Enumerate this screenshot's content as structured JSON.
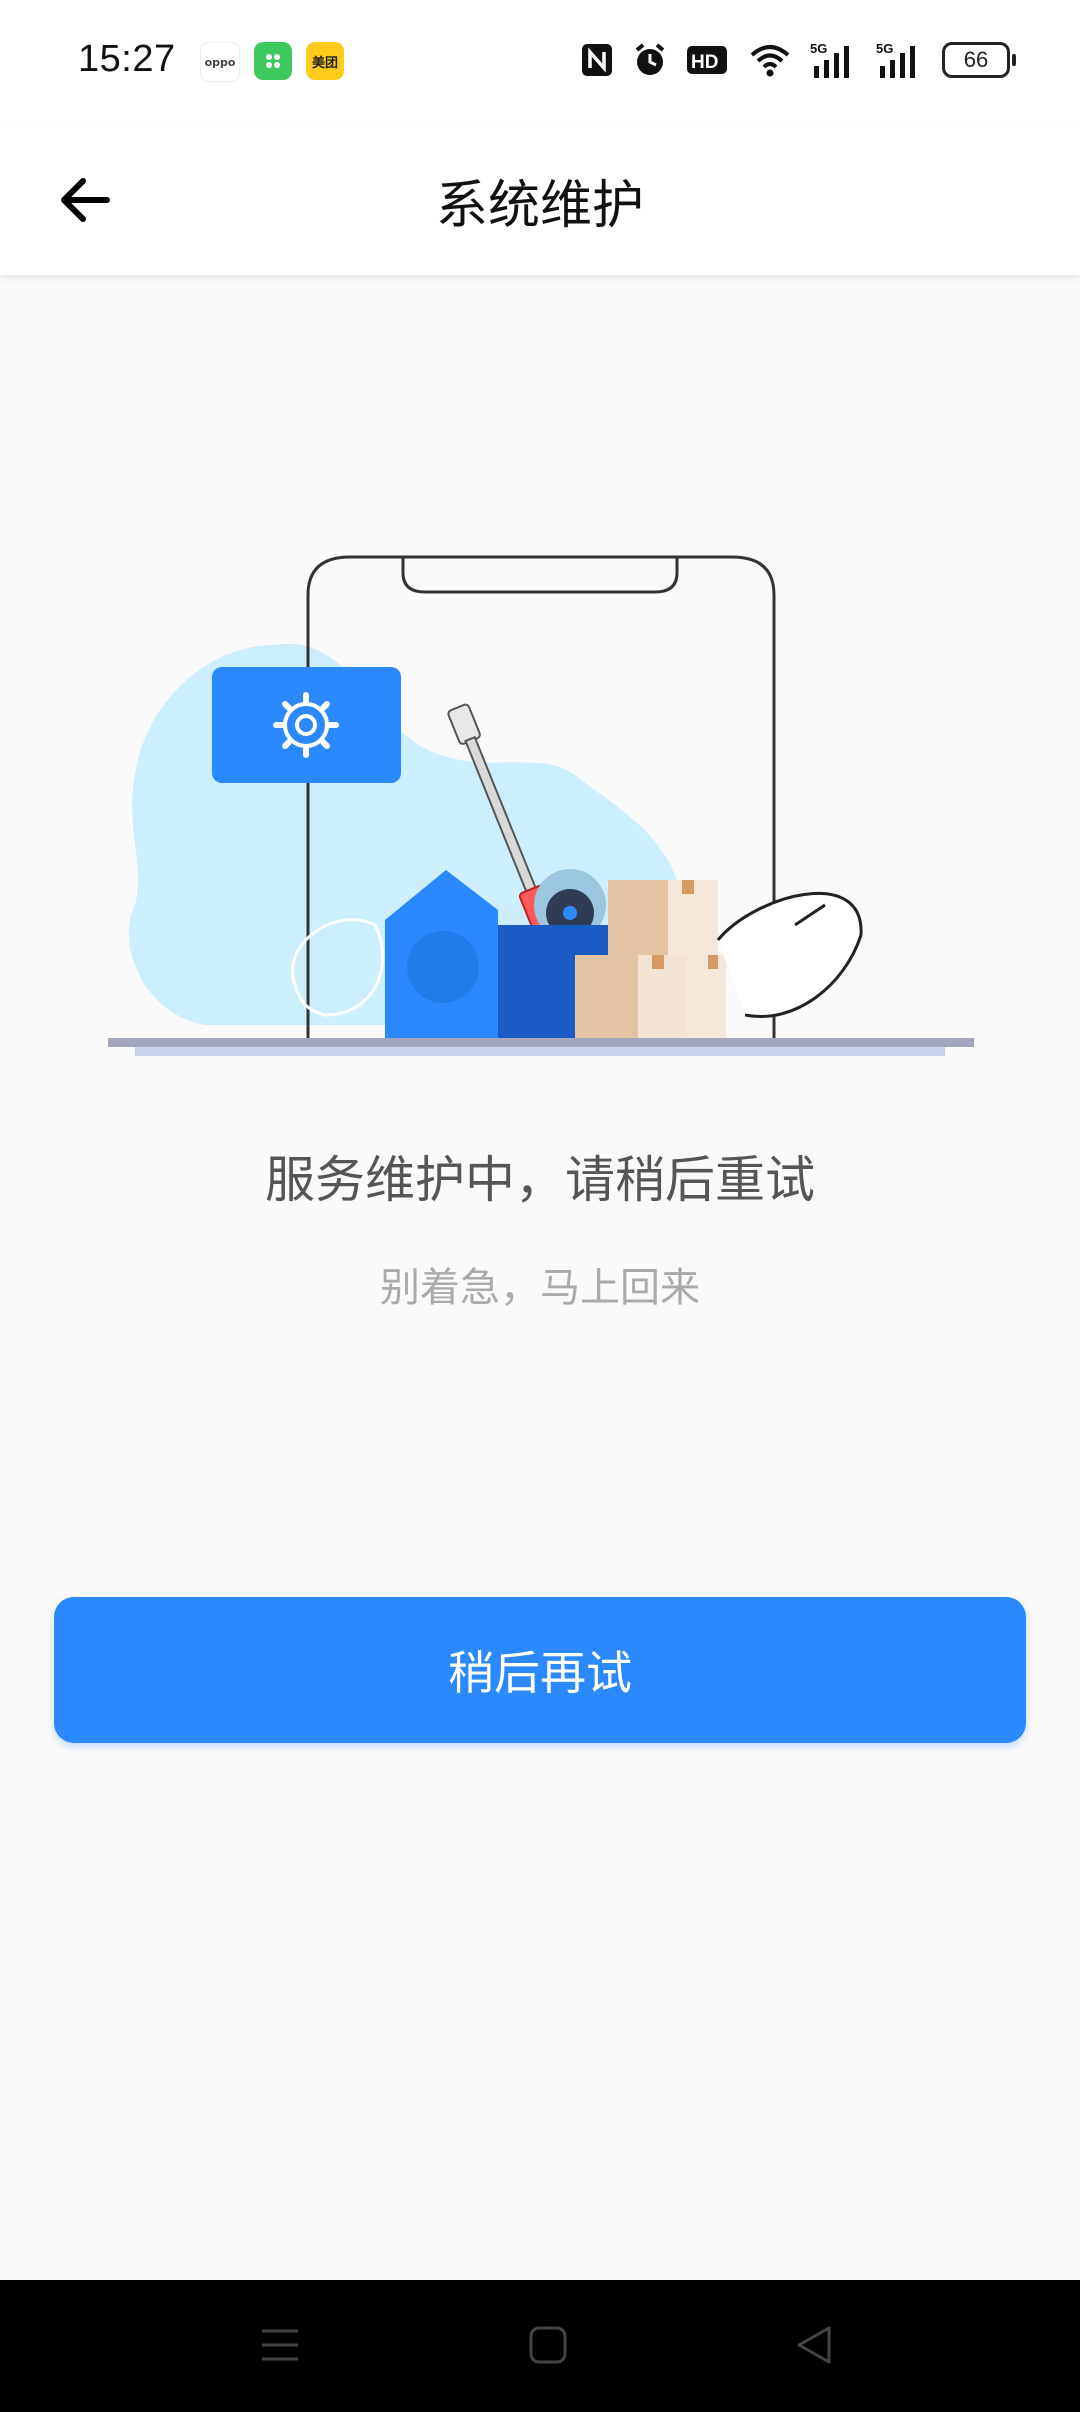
{
  "status_bar": {
    "time": "15:27",
    "notifications": [
      {
        "name": "oppo-app-icon",
        "text": "oppo"
      },
      {
        "name": "green-app-icon",
        "text": ""
      },
      {
        "name": "meituan-icon",
        "text": "美团"
      }
    ],
    "network_5g_1": "5G",
    "network_5g_2": "5G",
    "hd_label": "HD",
    "battery": "66"
  },
  "header": {
    "title": "系统维护"
  },
  "main": {
    "message": "服务维护中，请稍后重试",
    "submessage": "别着急，马上回来",
    "retry_label": "稍后再试"
  },
  "colors": {
    "accent": "#2b89fd",
    "blob": "#cdeefd",
    "box_dark": "#1a5bc4",
    "carton": "#e2c3a3"
  },
  "icons": {
    "back": "arrow-left-icon",
    "settings": "gear-icon",
    "nav_menu": "menu-icon",
    "nav_home": "home-square-icon",
    "nav_back": "triangle-back-icon"
  }
}
